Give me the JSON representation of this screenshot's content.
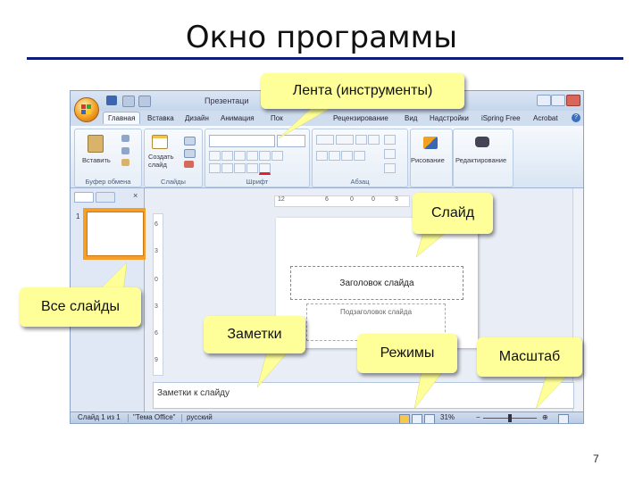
{
  "slide": {
    "title": "Окно программы",
    "page_number": "7"
  },
  "app": {
    "title": "Презентаци",
    "tabs": [
      "Главная",
      "Вставка",
      "Дизайн",
      "Анимация",
      "Пок",
      "Рецензирование",
      "Вид",
      "Надстройки",
      "iSpring Free",
      "Acrobat"
    ],
    "ribbon": {
      "clipboard": {
        "label": "Буфер обмена",
        "paste": "Вставить"
      },
      "slides": {
        "label": "Слайды",
        "new_slide": "Создать слайд"
      },
      "font": {
        "label": "Шрифт"
      },
      "paragraph": {
        "label": "Абзац"
      },
      "drawing": {
        "label": "Рисование"
      },
      "editing": {
        "label": "Редактирование"
      }
    },
    "thumbnail_number": "1",
    "ruler_h": [
      "12",
      "6",
      "0",
      "0",
      "3"
    ],
    "ruler_v": [
      "6",
      "3",
      "0",
      "3",
      "6",
      "9"
    ],
    "slide": {
      "title_placeholder": "Заголовок слайда",
      "subtitle_placeholder": "Подзаголовок слайда"
    },
    "notes_placeholder": "Заметки к слайду",
    "status": {
      "slide_of": "Слайд 1 из 1",
      "theme": "\"Тема Office\"",
      "language": "русский",
      "zoom": "31%"
    }
  },
  "callouts": {
    "ribbon": "Лента (инструменты)",
    "slide": "Слайд",
    "all_slides": "Все слайды",
    "notes": "Заметки",
    "views": "Режимы",
    "zoom": "Масштаб"
  },
  "colors": {
    "callout_fill": "#ffff99",
    "title_rule": "#0c1c7a",
    "thumbnail_border": "#f59e2a"
  }
}
